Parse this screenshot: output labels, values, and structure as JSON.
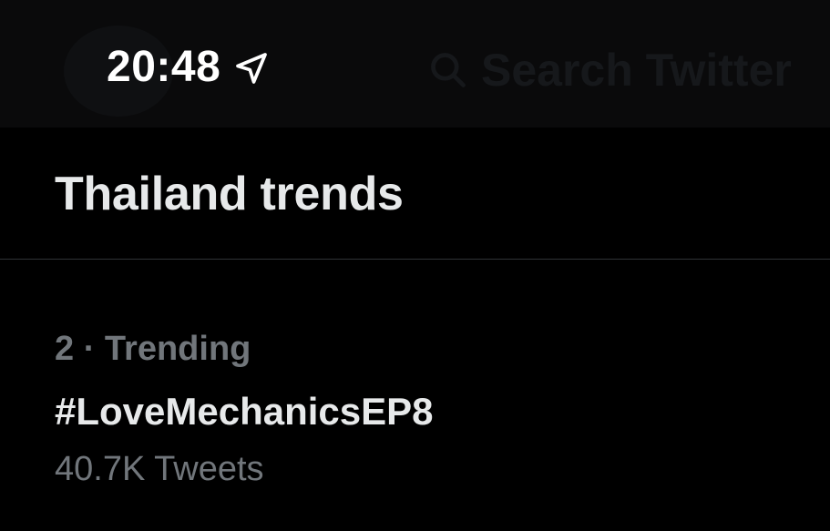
{
  "status_bar": {
    "time": "20:48",
    "location_icon": "location-arrow-icon"
  },
  "header": {
    "search_placeholder": "Search Twitter",
    "search_icon": "search-icon"
  },
  "section": {
    "title": "Thailand trends"
  },
  "trends": [
    {
      "rank": "2",
      "separator": "·",
      "category": "Trending",
      "name": "#LoveMechanicsEP8",
      "tweet_count": "40.7K Tweets"
    }
  ],
  "colors": {
    "background": "#000000",
    "primary_text": "#e7e9ea",
    "secondary_text": "#71767b",
    "divider": "#2f3336"
  }
}
